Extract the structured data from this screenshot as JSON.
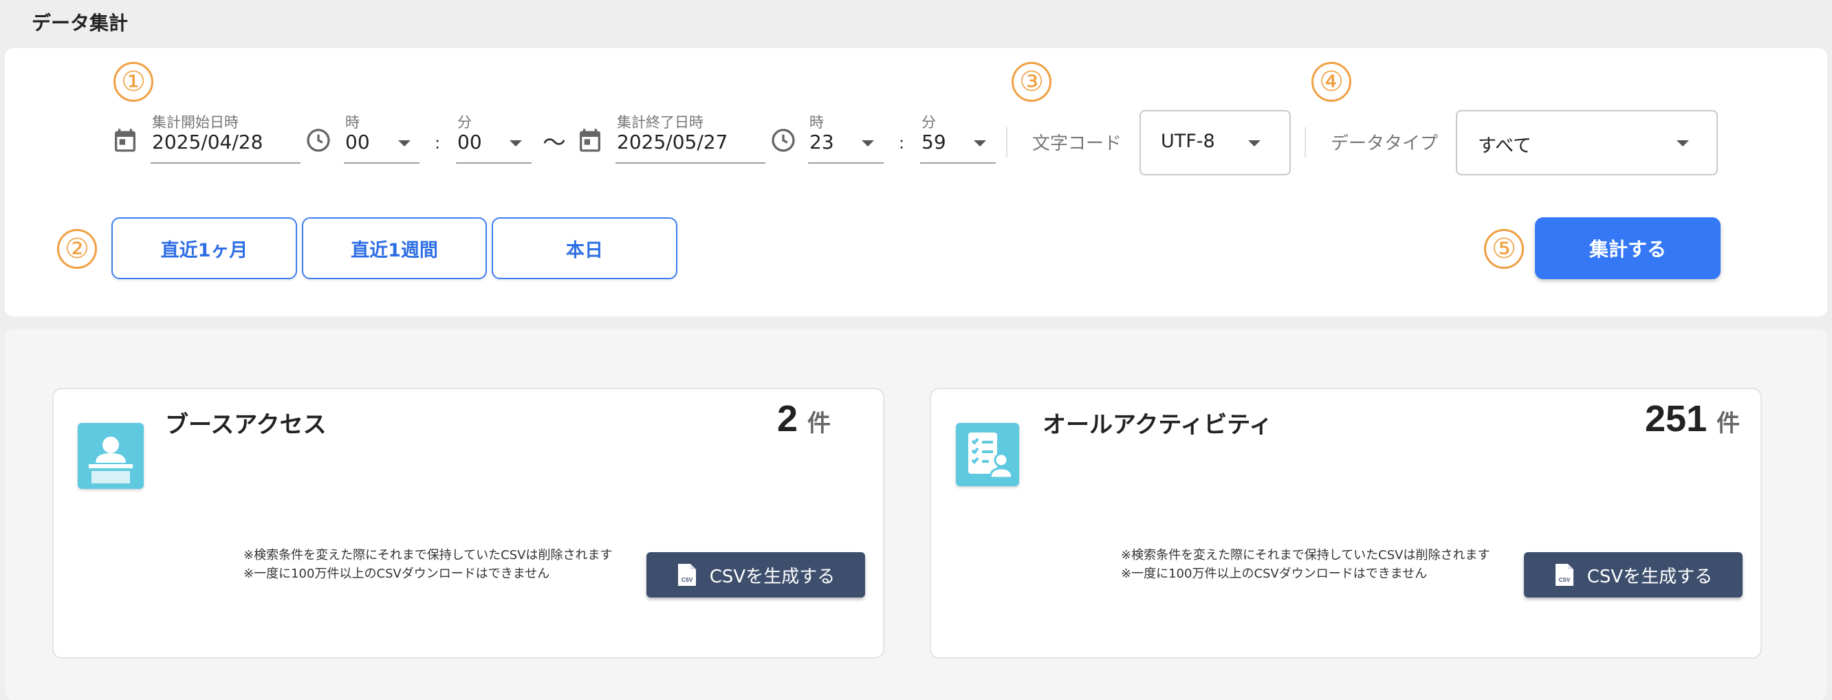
{
  "page": {
    "title": "データ集計"
  },
  "markers": [
    "①",
    "②",
    "③",
    "④",
    "⑤"
  ],
  "date_range": {
    "start": {
      "label": "集計開始日時",
      "date": "2025/04/28",
      "hour_label": "時",
      "hour": "00",
      "minute_label": "分",
      "minute": "00"
    },
    "separator": "〜",
    "colon": ":",
    "end": {
      "label": "集計終了日時",
      "date": "2025/05/27",
      "hour_label": "時",
      "hour": "23",
      "minute_label": "分",
      "minute": "59"
    }
  },
  "encoding": {
    "label": "文字コード",
    "value": "UTF-8"
  },
  "data_type": {
    "label": "データタイプ",
    "value": "すべて"
  },
  "quick_ranges": [
    "直近1ヶ月",
    "直近1週間",
    "本日"
  ],
  "aggregate_button": "集計する",
  "cards": [
    {
      "icon": "booth-person-icon",
      "title": "ブースアクセス",
      "count": "2",
      "unit": "件",
      "notes": [
        "※検索条件を変えた際にそれまで保持していたCSVは削除されます",
        "※一度に100万件以上のCSVダウンロードはできません"
      ],
      "button": "CSVを生成する"
    },
    {
      "icon": "activity-list-icon",
      "title": "オールアクティビティ",
      "count": "251",
      "unit": "件",
      "notes": [
        "※検索条件を変えた際にそれまで保持していたCSVは削除されます",
        "※一度に100万件以上のCSVダウンロードはできません"
      ],
      "button": "CSVを生成する"
    }
  ],
  "colors": {
    "accent_blue": "#3478f6",
    "marker_orange": "#f0a043",
    "csv_button": "#3e4f6e",
    "card_icon": "#5fc9e0"
  }
}
